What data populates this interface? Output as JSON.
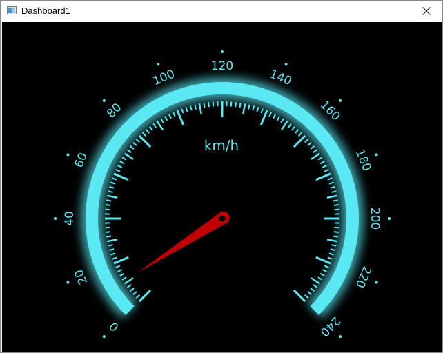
{
  "window": {
    "title": "Dashboard1",
    "close_icon": "close-icon",
    "app_icon": "window-app-icon"
  },
  "gauge": {
    "unit": "km/h",
    "min": 0,
    "max": 240,
    "labels": [
      "0",
      "20",
      "40",
      "60",
      "80",
      "100",
      "120",
      "140",
      "160",
      "180",
      "200",
      "220",
      "240"
    ],
    "value": 11,
    "colors": {
      "accent": "#5ae8f3",
      "needle": "#c00000",
      "background": "#000000"
    }
  }
}
